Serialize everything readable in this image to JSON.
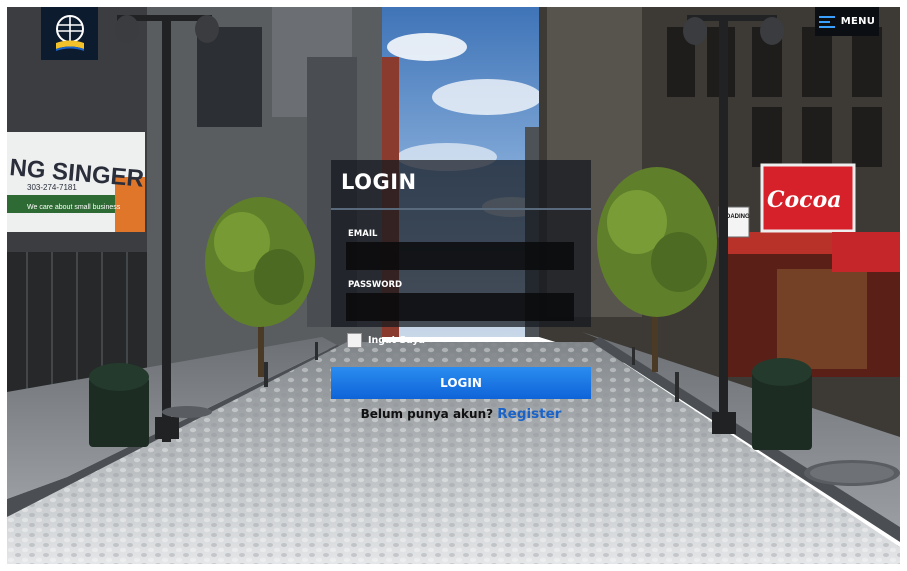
{
  "menu": {
    "label": "MENU",
    "icon": "hamburger-icon",
    "icon_color": "#3aa0ff"
  },
  "logo": {
    "icon": "university-logo-icon"
  },
  "login": {
    "title": "LOGIN",
    "email_label": "EMAIL",
    "email_value": "",
    "password_label": "PASSWORD",
    "password_value": "",
    "remember_label": "Ingat Saya",
    "remember_checked": false,
    "submit_label": "LOGIN",
    "register_prompt": "Belum punya akun?",
    "register_link": "Register"
  },
  "scene_signs": {
    "shop_left": "NG SINGER",
    "shop_left_phone": "303-274-7181",
    "shop_left_tagline": "We care about small business",
    "loading_zone": "LOADING",
    "cocoa_brand": "Cocoa"
  },
  "colors": {
    "accent": "#1a63c9",
    "button_top": "#2a8cf0",
    "button_bottom": "#0f64d8",
    "panel": "#14181e"
  }
}
